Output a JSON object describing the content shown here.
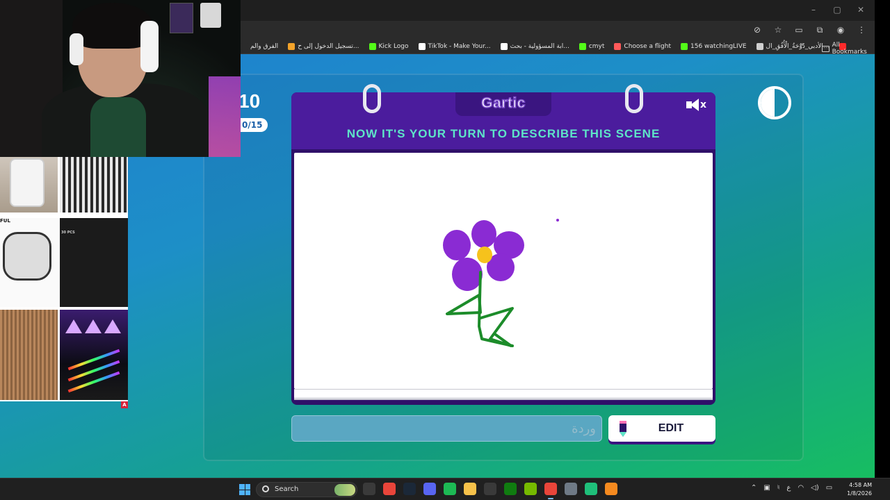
{
  "window_controls": [
    "–",
    "▢",
    "✕"
  ],
  "address_bar_icons": [
    "eye-off-icon",
    "star-icon",
    "tab-search-icon",
    "extensions-icon",
    "profile-icon",
    "kebab-menu-icon"
  ],
  "bookmarks": {
    "items": [
      {
        "label": "الفرق والم",
        "icon": "none",
        "color": "#2b2b2b"
      },
      {
        "label": "تسجيل الدخول إلى ح...",
        "icon": "windows-icon",
        "color": "#f3a32a"
      },
      {
        "label": "Kick Logo",
        "icon": "kick-icon",
        "color": "#53fc18"
      },
      {
        "label": "TikTok - Make Your...",
        "icon": "tiktok-icon",
        "color": "#ffffff"
      },
      {
        "label": "ابة المسؤولية - بحث...",
        "icon": "google-icon",
        "color": "#ffffff"
      },
      {
        "label": "cmyt",
        "icon": "kick-icon",
        "color": "#53fc18"
      },
      {
        "label": "Choose a flight",
        "icon": "plane-icon",
        "color": "#ff5a5a"
      },
      {
        "label": "156 watchingLIVE",
        "icon": "kick-icon",
        "color": "#53fc18"
      },
      {
        "label": "الأدبي_دُوْحَةُ_الْأُفُقِ_ال...",
        "icon": "globe-icon",
        "color": "#cfcfcf"
      },
      {
        "label": "",
        "icon": "youtube-icon",
        "color": "#ff2a2a"
      }
    ],
    "more_label": "»",
    "all_bookmarks_label": "All Bookmarks"
  },
  "game": {
    "score": "10",
    "round": "0/15",
    "logo": "Gartic",
    "prompt": "NOW IT'S YOUR TURN TO DESCRIBE THIS SCENE",
    "mute_icon": "speaker-muted-icon",
    "contrast_icon": "contrast-toggle-icon",
    "drawing": {
      "flower_color": "#8a2bd3",
      "center_color": "#f6c21c",
      "stem_color": "#1c8c2a"
    },
    "answer_placeholder": "وردة",
    "answer_value": "",
    "edit_label": "EDIT"
  },
  "sidebar": {
    "tile3_text": "FUL",
    "tile4_text": "30 PCS",
    "ad_badge": "A"
  },
  "taskbar": {
    "search_label": "Search",
    "apps": [
      {
        "name": "camera-app",
        "color": "#3a3a3a",
        "active": false
      },
      {
        "name": "chrome-app",
        "color": "#e9453a",
        "active": false
      },
      {
        "name": "steam-app",
        "color": "#1b2838",
        "active": false
      },
      {
        "name": "discord-app",
        "color": "#5865f2",
        "active": false
      },
      {
        "name": "spotify-app",
        "color": "#1db954",
        "active": false
      },
      {
        "name": "explorer-app",
        "color": "#f6c14a",
        "active": false
      },
      {
        "name": "store-app",
        "color": "#3a3a3a",
        "active": false
      },
      {
        "name": "xbox-app",
        "color": "#107c10",
        "active": false
      },
      {
        "name": "nvidia-app",
        "color": "#76b900",
        "active": false
      },
      {
        "name": "chrome-active-app",
        "color": "#e9453a",
        "active": true
      },
      {
        "name": "settings-app",
        "color": "#6f7a86",
        "active": false
      },
      {
        "name": "green-app",
        "color": "#1fbf7a",
        "active": false
      },
      {
        "name": "orange-app",
        "color": "#f58a1f",
        "active": false
      }
    ],
    "tray_lang": "ع",
    "time": "4:58 AM",
    "date": "1/8/2026"
  }
}
